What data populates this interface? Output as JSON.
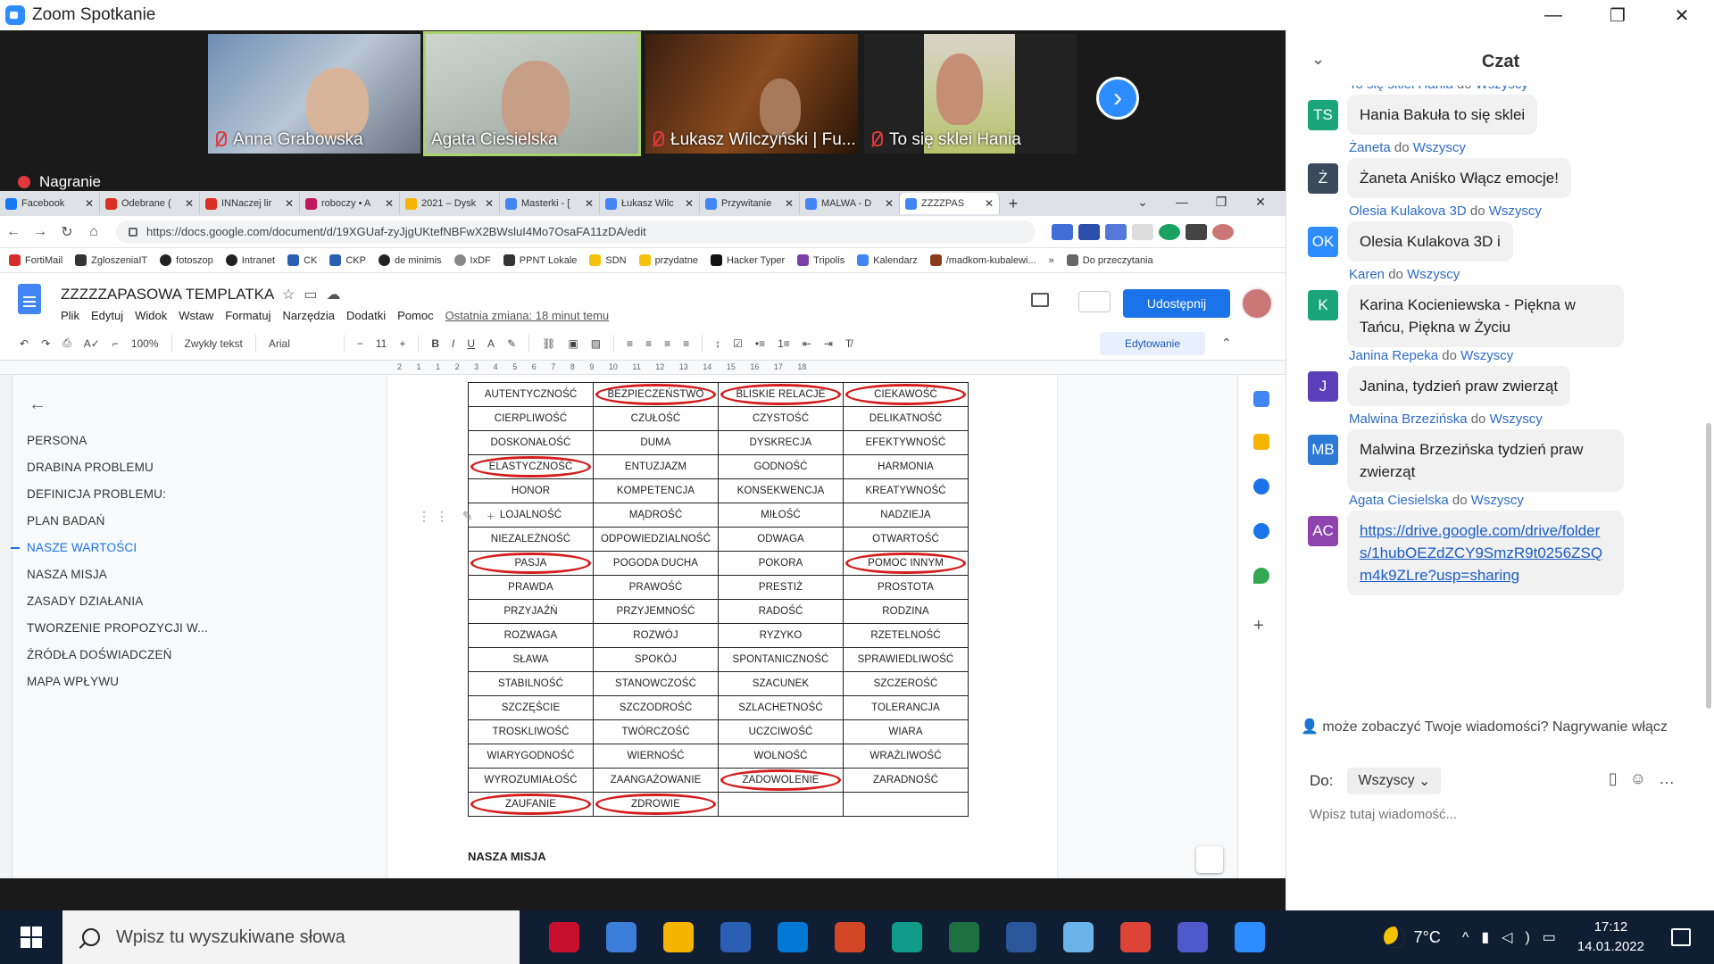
{
  "zoom": {
    "title": "Zoom Spotkanie",
    "window_controls": [
      "—",
      "❐",
      "✕"
    ],
    "participants": [
      {
        "name": "Anna Grabowska",
        "muted": true
      },
      {
        "name": "Agata Ciesielska",
        "muted": false
      },
      {
        "name": "Łukasz Wilczyński | Fu...",
        "muted": true
      },
      {
        "name": "To się sklei Hania",
        "muted": true
      }
    ],
    "next_arrow": "›",
    "recording_label": "Nagranie"
  },
  "browser": {
    "tabs": [
      {
        "label": "Facebook",
        "color": "#1877f2"
      },
      {
        "label": "Odebrane (",
        "color": "#d93025"
      },
      {
        "label": "INNaczej lir",
        "color": "#d93025"
      },
      {
        "label": "roboczy • A",
        "color": "#c2185b"
      },
      {
        "label": "2021 – Dysk",
        "color": "#f4b400"
      },
      {
        "label": "Masterki - [",
        "color": "#4285f4"
      },
      {
        "label": "Łukasz Wilc",
        "color": "#4285f4"
      },
      {
        "label": "Przywitanie",
        "color": "#4285f4"
      },
      {
        "label": "MALWA - D",
        "color": "#4285f4"
      },
      {
        "label": "ZZZZPAS",
        "color": "#4285f4"
      }
    ],
    "url": "https://docs.google.com/document/d/19XGUaf-zyJjgUKtefNBFwX2BWsluI4Mo7OsaFA11zDA/edit",
    "bookmarks": [
      "FortiMail",
      "ZgloszeniaIT",
      "fotoszop",
      "Intranet",
      "CK",
      "CKP",
      "de minimis",
      "IxDF",
      "PPNT Lokale",
      "SDN",
      "przydatne",
      "Hacker Typer",
      "Tripolis",
      "Kalendarz",
      "/madkom-kubalewi...",
      "»",
      "Do przeczytania"
    ]
  },
  "docs": {
    "title": "ZZZZZAPASOWA TEMPLATKA",
    "menu": [
      "Plik",
      "Edytuj",
      "Widok",
      "Wstaw",
      "Formatuj",
      "Narzędzia",
      "Dodatki",
      "Pomoc"
    ],
    "last_edit": "Ostatnia zmiana: 18 minut temu",
    "share_label": "Udostępnij",
    "toolbar": {
      "zoom": "100%",
      "style": "Zwykły tekst",
      "font": "Arial",
      "size": "11",
      "mode": "Edytowanie"
    },
    "ruler": [
      "2",
      "1",
      "1",
      "2",
      "3",
      "4",
      "5",
      "6",
      "7",
      "8",
      "9",
      "10",
      "11",
      "12",
      "13",
      "14",
      "15",
      "16",
      "17",
      "18"
    ],
    "outline": [
      "PERSONA",
      "DRABINA PROBLEMU",
      "DEFINICJA PROBLEMU:",
      "PLAN BADAŃ",
      "NASZE WARTOŚCI",
      "NASZA MISJA",
      "ZASADY DZIAŁANIA",
      "TWORZENIE PROPOZYCJI W...",
      "ŹRÓDŁA DOŚWIADCZEŃ",
      "MAPA WPŁYWU"
    ],
    "outline_active": "NASZE WARTOŚCI",
    "values_table": [
      [
        "AUTENTYCZNOŚĆ",
        "BEZPIECZEŃSTWO",
        "BLISKIE RELACJE",
        "CIEKAWOŚĆ"
      ],
      [
        "CIERPLIWOŚĆ",
        "CZUŁOŚĆ",
        "CZYSTOŚĆ",
        "DELIKATNOŚĆ"
      ],
      [
        "DOSKONAŁOŚĆ",
        "DUMA",
        "DYSKRECJA",
        "EFEKTYWNOŚĆ"
      ],
      [
        "ELASTYCZNOŚĆ",
        "ENTUZJAZM",
        "GODNOŚĆ",
        "HARMONIA"
      ],
      [
        "HONOR",
        "KOMPETENCJA",
        "KONSEKWENCJA",
        "KREATYWNOŚĆ"
      ],
      [
        "LOJALNOŚĆ",
        "MĄDROŚĆ",
        "MIŁOŚĆ",
        "NADZIEJA"
      ],
      [
        "NIEZALEŻNOŚĆ",
        "ODPOWIEDZIALNOŚĆ",
        "ODWAGA",
        "OTWARTOŚĆ"
      ],
      [
        "PASJA",
        "POGODA DUCHA",
        "POKORA",
        "POMOC INNYM"
      ],
      [
        "PRAWDA",
        "PRAWOŚĆ",
        "PRESTIŻ",
        "PROSTOTA"
      ],
      [
        "PRZYJAŹŃ",
        "PRZYJEMNOŚĆ",
        "RADOŚĆ",
        "RODZINA"
      ],
      [
        "ROZWAGA",
        "ROZWÓJ",
        "RYZYKO",
        "RZETELNOŚĆ"
      ],
      [
        "SŁAWA",
        "SPOKÓJ",
        "SPONTANICZNOŚĆ",
        "SPRAWIEDLIWOŚĆ"
      ],
      [
        "STABILNOŚĆ",
        "STANOWCZOŚĆ",
        "SZACUNEK",
        "SZCZEROŚĆ"
      ],
      [
        "SZCZĘŚCIE",
        "SZCZODROŚĆ",
        "SZLACHETNOŚĆ",
        "TOLERANCJA"
      ],
      [
        "TROSKLIWOŚĆ",
        "TWÓRCZOŚĆ",
        "UCZCIWOŚĆ",
        "WIARA"
      ],
      [
        "WIARYGODNOŚĆ",
        "WIERNOŚĆ",
        "WOLNOŚĆ",
        "WRAŻLIWOŚĆ"
      ],
      [
        "WYROZUMIAŁOŚĆ",
        "ZAANGAŻOWANIE",
        "ZADOWOLENIE",
        "ZARADNOŚĆ"
      ],
      [
        "ZAUFANIE",
        "ZDROWIE",
        "",
        ""
      ]
    ],
    "circled": [
      "BEZPIECZEŃSTWO",
      "BLISKIE RELACJE",
      "CIEKAWOŚĆ",
      "ELASTYCZNOŚĆ",
      "PASJA",
      "POMOC INNYM",
      "ZADOWOLENIE",
      "ZAUFANIE",
      "ZDROWIE"
    ],
    "mission_heading": "NASZA MISJA"
  },
  "chat": {
    "title": "Czat",
    "to_word": "do",
    "messages": [
      {
        "from": "To się sklei Hania",
        "to": "Wszyscy",
        "initials": "TS",
        "color": "#1aa67a",
        "text": "Hania Bakuła to się sklei"
      },
      {
        "from": "Żaneta",
        "to": "Wszyscy",
        "initials": "Ż",
        "color": "#3a4a5c",
        "text": "Żaneta Aniśko Włącz emocje!"
      },
      {
        "from": "Olesia Kulakova 3D",
        "to": "Wszyscy",
        "initials": "OK",
        "color": "#2d8cff",
        "text": "Olesia Kulakova 3D i"
      },
      {
        "from": "Karen",
        "to": "Wszyscy",
        "initials": "K",
        "color": "#1aa67a",
        "text": "Karina Kocieniewska - Piękna w Tańcu, Piękna w Życiu"
      },
      {
        "from": "Janina Repeka",
        "to": "Wszyscy",
        "initials": "J",
        "color": "#5b3fb8",
        "text": "Janina, tydzień praw zwierząt"
      },
      {
        "from": "Malwina Brzezińska",
        "to": "Wszyscy",
        "initials": "MB",
        "color": "#2d7ad6",
        "text": "Malwina Brzezińska tydzień praw zwierząt"
      },
      {
        "from": "Agata Ciesielska",
        "to": "Wszyscy",
        "initials": "AC",
        "color": "#8e44ad",
        "link": "https://drive.google.com/drive/folders/1hubOEZdZCY9SmzR9t0256ZSQm4k9ZLre?usp=sharing"
      }
    ],
    "notice": "może zobaczyć Twoje wiadomości? Nagrywanie włącz",
    "to_label": "Do:",
    "to_value": "Wszyscy",
    "input_placeholder": "Wpisz tutaj wiadomość..."
  },
  "taskbar": {
    "search_placeholder": "Wpisz tu wyszukiwane słowa",
    "apps": [
      {
        "name": "mcafee",
        "color": "#c8102e"
      },
      {
        "name": "globe",
        "color": "#3b7dd8"
      },
      {
        "name": "explorer",
        "color": "#f4b400"
      },
      {
        "name": "save-disk",
        "color": "#2b5fb4"
      },
      {
        "name": "store",
        "color": "#0078d4"
      },
      {
        "name": "powerpoint",
        "color": "#d24726"
      },
      {
        "name": "edge",
        "color": "#0f9d8a"
      },
      {
        "name": "excel",
        "color": "#1d6f42"
      },
      {
        "name": "word",
        "color": "#2b579a"
      },
      {
        "name": "paint",
        "color": "#6bb3e8"
      },
      {
        "name": "chrome",
        "color": "#db4437"
      },
      {
        "name": "teams",
        "color": "#5059c9"
      },
      {
        "name": "zoom",
        "color": "#2d8cff"
      }
    ],
    "temperature": "7°C",
    "time": "17:12",
    "date": "14.01.2022"
  }
}
